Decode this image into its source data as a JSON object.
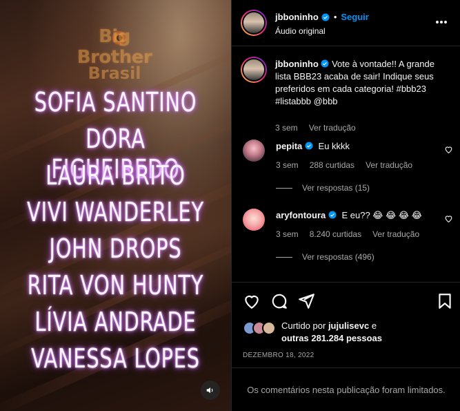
{
  "media": {
    "logo_text_line1": "Big Brother",
    "logo_text_line2": "Brasil",
    "names": [
      "SOFIA SANTINO",
      "DORA FIGUEIREDO",
      "LAURA BRITO",
      "VIVI WANDERLEY",
      "JOHN DROPS",
      "RITA VON HUNTY",
      "LÍVIA ANDRADE",
      "VANESSA LOPES"
    ],
    "audio_icon": "speaker-icon"
  },
  "header": {
    "username": "jbboninho",
    "separator": "•",
    "follow_label": "Seguir",
    "audio_label": "Áudio original",
    "more_icon": "ellipsis-icon"
  },
  "caption": {
    "username": "jbboninho",
    "text": "Vote à vontade!! A grande lista BBB23 acaba de sair! Indique seus preferidos em cada categoria! #bbb23 #listabbb @bbb",
    "time": "3 sem",
    "translate": "Ver tradução"
  },
  "comments": [
    {
      "username": "pepita",
      "text": "Eu kkkk",
      "time": "3 sem",
      "likes": "288 curtidas",
      "translate": "Ver tradução",
      "replies": "Ver respostas (15)"
    },
    {
      "username": "aryfontoura",
      "text": "E eu?? 😂 😂 😂 😂",
      "time": "3 sem",
      "likes": "8.240 curtidas",
      "translate": "Ver tradução",
      "replies": "Ver respostas (496)"
    }
  ],
  "actions": {
    "like_icon": "heart-icon",
    "comment_icon": "comment-icon",
    "share_icon": "send-icon",
    "save_icon": "bookmark-icon"
  },
  "likes": {
    "prefix": "Curtido por",
    "user": "jujulisevc",
    "connector": "e",
    "others": "outras 281.284 pessoas"
  },
  "date": "DEZEMBRO 18, 2022",
  "comments_limited": "Os comentários nesta publicação foram limitados.",
  "colors": {
    "accent": "#0095f6",
    "background": "#000000",
    "secondary_text": "#a8a8a8",
    "neon_glow": "#d78bff"
  }
}
